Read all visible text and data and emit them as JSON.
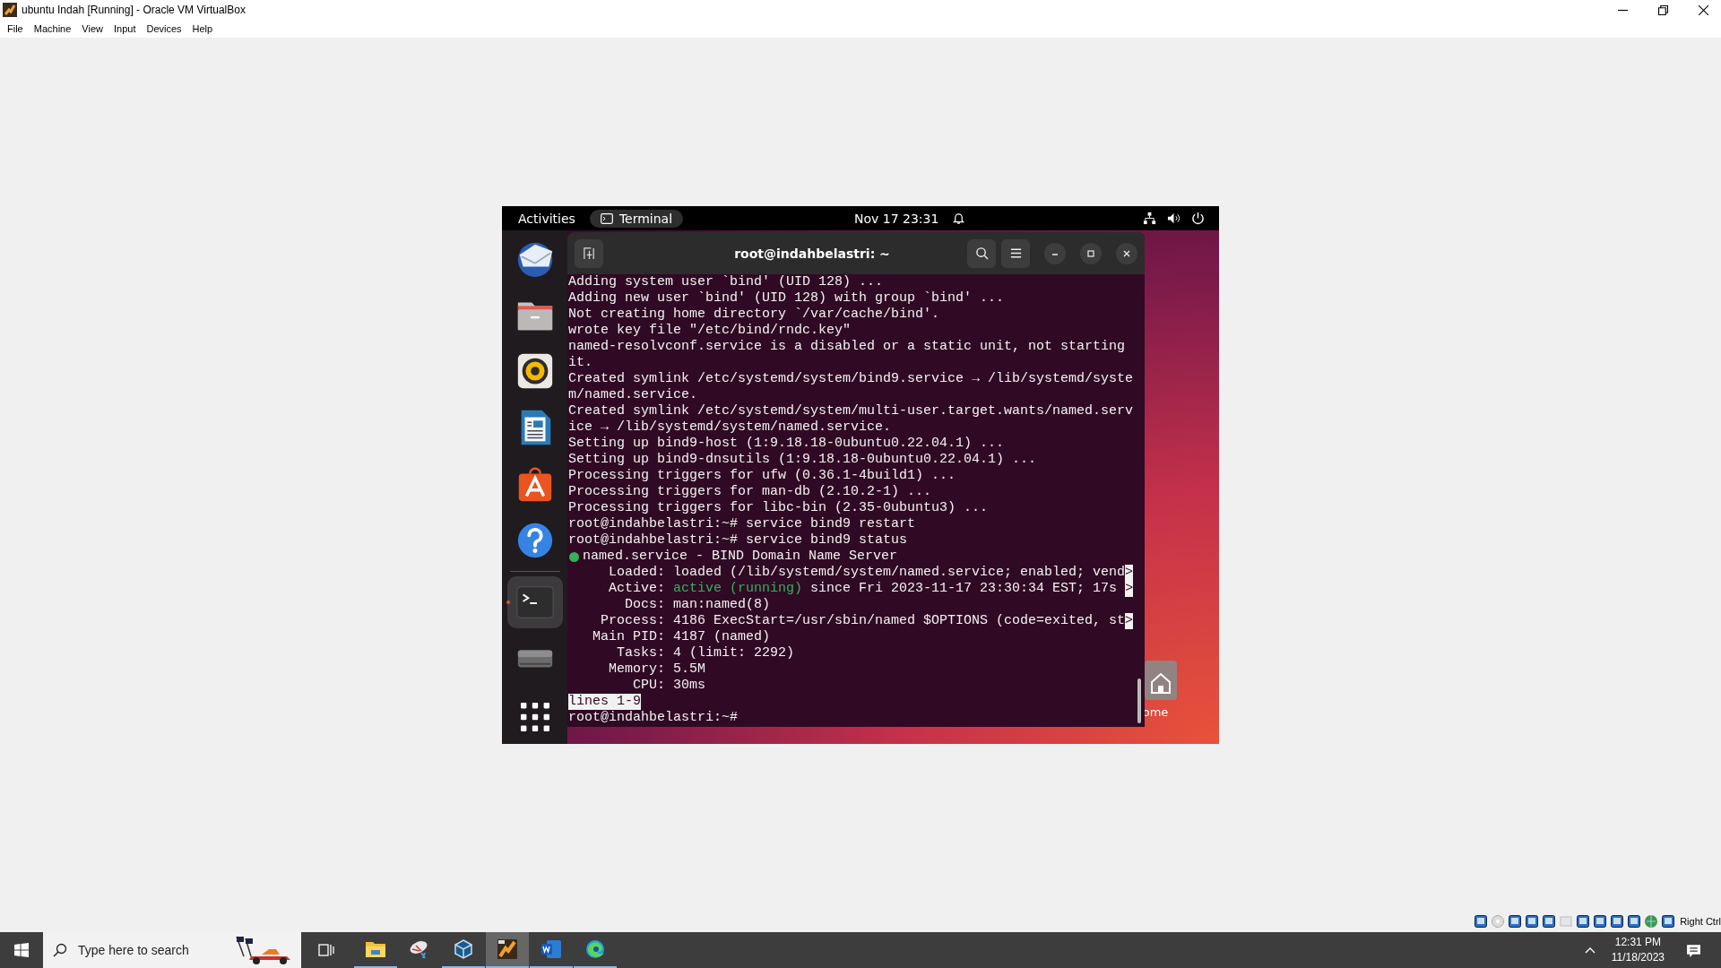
{
  "window": {
    "title": "ubuntu Indah [Running] - Oracle VM VirtualBox"
  },
  "menu": [
    "File",
    "Machine",
    "View",
    "Input",
    "Devices",
    "Help"
  ],
  "vm": {
    "top_bar": {
      "activities": "Activities",
      "app": "Terminal",
      "clock": "Nov 17  23:31"
    },
    "dock": [
      {
        "kind": "mail",
        "selected": false
      },
      {
        "kind": "files",
        "selected": false
      },
      {
        "kind": "music",
        "selected": false
      },
      {
        "kind": "writer",
        "selected": false
      },
      {
        "kind": "appstore",
        "selected": false
      },
      {
        "kind": "help",
        "selected": false
      },
      {
        "kind": "terminal",
        "selected": true
      },
      {
        "kind": "drive",
        "selected": false
      }
    ],
    "terminal": {
      "title": "root@indahbelastri: ~",
      "lines": [
        {
          "kind": "text",
          "text": "Adding system user `bind' (UID 128) ..."
        },
        {
          "kind": "text",
          "text": "Adding new user `bind' (UID 128) with group `bind' ..."
        },
        {
          "kind": "text",
          "text": "Not creating home directory `/var/cache/bind'."
        },
        {
          "kind": "text",
          "text": "wrote key file \"/etc/bind/rndc.key\""
        },
        {
          "kind": "text",
          "text": "named-resolvconf.service is a disabled or a static unit, not starting"
        },
        {
          "kind": "text",
          "text": "it."
        },
        {
          "kind": "text",
          "text": "Created symlink /etc/systemd/system/bind9.service → /lib/systemd/syste"
        },
        {
          "kind": "text",
          "text": "m/named.service."
        },
        {
          "kind": "text",
          "text": "Created symlink /etc/systemd/system/multi-user.target.wants/named.serv"
        },
        {
          "kind": "text",
          "text": "ice → /lib/systemd/system/named.service."
        },
        {
          "kind": "text",
          "text": "Setting up bind9-host (1:9.18.18-0ubuntu0.22.04.1) ..."
        },
        {
          "kind": "text",
          "text": "Setting up bind9-dnsutils (1:9.18.18-0ubuntu0.22.04.1) ..."
        },
        {
          "kind": "text",
          "text": "Processing triggers for ufw (0.36.1-4build1) ..."
        },
        {
          "kind": "text",
          "text": "Processing triggers for man-db (2.10.2-1) ..."
        },
        {
          "kind": "text",
          "text": "Processing triggers for libc-bin (2.35-0ubuntu3) ..."
        },
        {
          "kind": "text",
          "text": "root@indahbelastri:~# service bind9 restart"
        },
        {
          "kind": "text",
          "text": "root@indahbelastri:~# service bind9 status"
        },
        {
          "kind": "unit",
          "color": "#33b05a",
          "text": "named.service - BIND Domain Name Server"
        },
        {
          "kind": "text",
          "text": "     Loaded: loaded (/lib/systemd/system/named.service; enabled; vend",
          "cut": ">"
        },
        {
          "kind": "active",
          "label": "     Active: ",
          "state": "active (running)",
          "text": " since Fri 2023-11-17 23:30:34 EST; 17s ",
          "cut": ">"
        },
        {
          "kind": "text",
          "text": "       Docs: man:named(8)"
        },
        {
          "kind": "text",
          "text": "    Process: 4186 ExecStart=/usr/sbin/named $OPTIONS (code=exited, st",
          "cut": ">"
        },
        {
          "kind": "text",
          "text": "   Main PID: 4187 (named)"
        },
        {
          "kind": "text",
          "text": "      Tasks: 4 (limit: 2292)"
        },
        {
          "kind": "text",
          "text": "     Memory: 5.5M"
        },
        {
          "kind": "text",
          "text": "        CPU: 30ms"
        },
        {
          "kind": "pager",
          "text": "lines 1-9"
        },
        {
          "kind": "text",
          "text": "root@indahbelastri:~#"
        }
      ]
    },
    "desktop_icons": [
      {
        "label": "ome"
      }
    ]
  },
  "host_keys": "Right Ctrl",
  "taskbar": {
    "search": {
      "placeholder": "Type here to search"
    },
    "apps": [
      {
        "kind": "explorer",
        "selected": false,
        "running": true
      },
      {
        "kind": "satellite",
        "selected": false,
        "running": false
      },
      {
        "kind": "virtualbox",
        "selected": false,
        "running": true
      },
      {
        "kind": "vm",
        "selected": true,
        "running": true
      },
      {
        "kind": "word",
        "selected": false,
        "running": true
      },
      {
        "kind": "edge",
        "selected": false,
        "running": true
      }
    ],
    "time": "12:31 PM",
    "date": "11/18/2023"
  }
}
